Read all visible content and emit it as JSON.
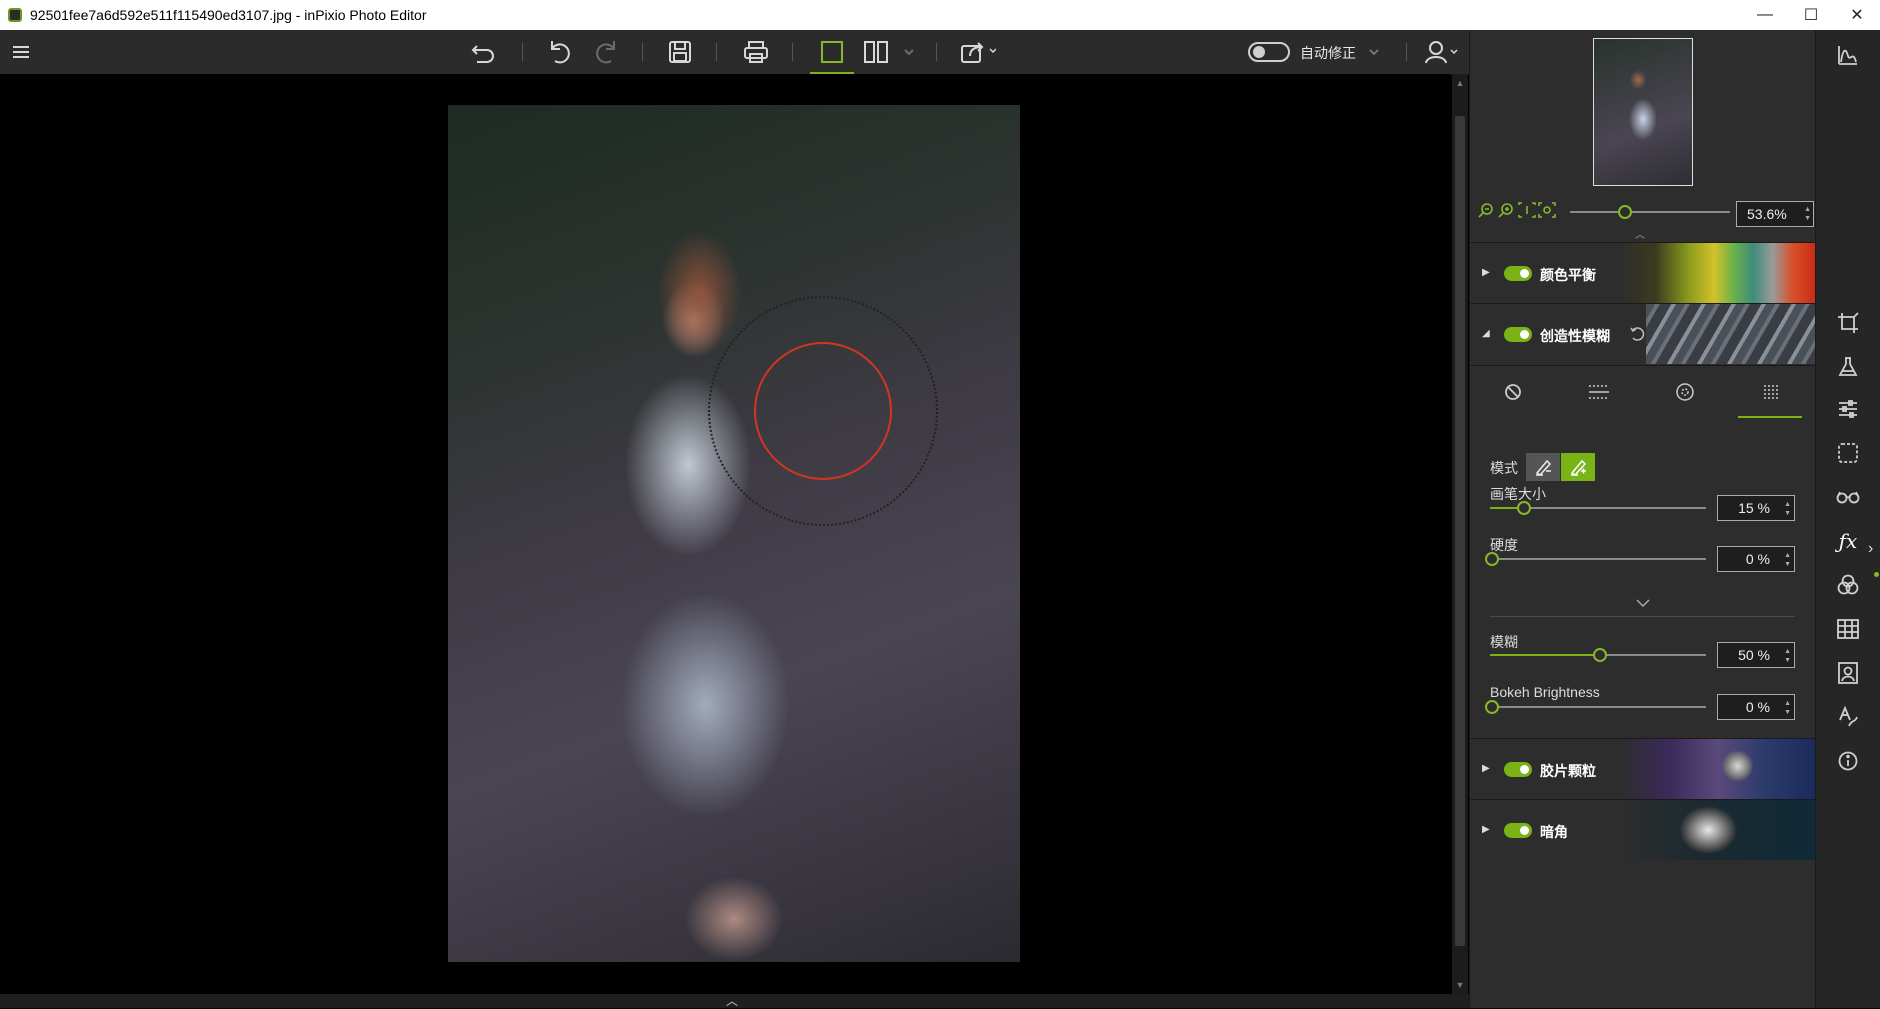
{
  "window": {
    "title": "92501fee7a6d592e511f115490ed3107.jpg - inPixio Photo Editor",
    "minimize": "—",
    "maximize": "☐",
    "close": "✕"
  },
  "toolbar": {
    "auto_fix_label": "自动修正"
  },
  "navigator": {
    "zoom_value": "53.6%"
  },
  "sections": [
    {
      "label": "颜色平衡",
      "expanded": false,
      "enabled": true
    },
    {
      "label": "创造性模糊",
      "expanded": true,
      "enabled": true
    },
    {
      "label": "胶片颗粒",
      "expanded": false,
      "enabled": true
    },
    {
      "label": "暗角",
      "expanded": false,
      "enabled": true
    }
  ],
  "blur_controls": {
    "mode_label": "模式",
    "brush_size_label": "画笔大小",
    "brush_size_value": "15 %",
    "brush_size_pct": 15,
    "hardness_label": "硬度",
    "hardness_value": "0 %",
    "hardness_pct": 0,
    "blur_label": "模糊",
    "blur_value": "50 %",
    "blur_pct": 50,
    "bokeh_label": "Bokeh Brightness",
    "bokeh_value": "0 %",
    "bokeh_pct": 0
  },
  "colors": {
    "accent": "#7ab317",
    "panel": "#2d2d2d",
    "brush_ring": "#d2361f"
  }
}
